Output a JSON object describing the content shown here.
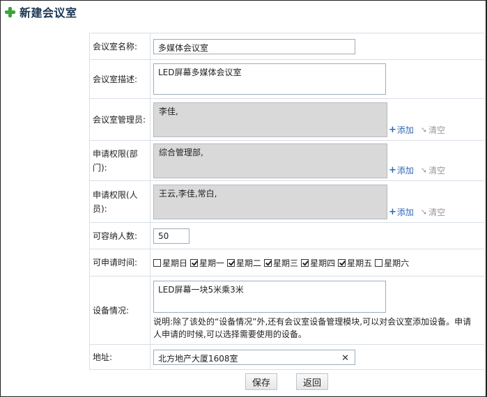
{
  "header": {
    "title": "新建会议室",
    "icon": "plus-icon"
  },
  "form": {
    "name": {
      "label": "会议室名称:",
      "value": "多媒体会议室"
    },
    "description": {
      "label": "会议室描述:",
      "value": "LED屏幕多媒体会议室"
    },
    "managers": {
      "label": "会议室管理员:",
      "value": "李佳,",
      "add": "添加",
      "clear": "清空"
    },
    "dept_permission": {
      "label": "申请权限(部门):",
      "value": "综合管理部,",
      "add": "添加",
      "clear": "清空"
    },
    "person_permission": {
      "label": "申请权限(人员):",
      "value": "王云,李佳,常白,",
      "add": "添加",
      "clear": "清空"
    },
    "capacity": {
      "label": "可容纳人数:",
      "value": "50"
    },
    "schedule": {
      "label": "可申请时间:",
      "days": [
        {
          "label": "星期日",
          "checked": false
        },
        {
          "label": "星期一",
          "checked": true
        },
        {
          "label": "星期二",
          "checked": true
        },
        {
          "label": "星期三",
          "checked": true
        },
        {
          "label": "星期四",
          "checked": true
        },
        {
          "label": "星期五",
          "checked": true
        },
        {
          "label": "星期六",
          "checked": false
        }
      ]
    },
    "equipment": {
      "label": "设备情况:",
      "value": "LED屏幕一块5米乘3米",
      "note": "说明:除了该处的“设备情况”外,还有会议室设备管理模块,可以对会议室添加设备。申请人申请的时候,可以选择需要使用的设备。"
    },
    "address": {
      "label": "地址:",
      "value": "北方地产大厦1608室"
    }
  },
  "buttons": {
    "save": "保存",
    "back": "返回"
  },
  "colors": {
    "link": "#2f68b4",
    "title": "#1a3552",
    "gray_box": "#d9d9d9",
    "accent_green": "#3aa43a"
  }
}
